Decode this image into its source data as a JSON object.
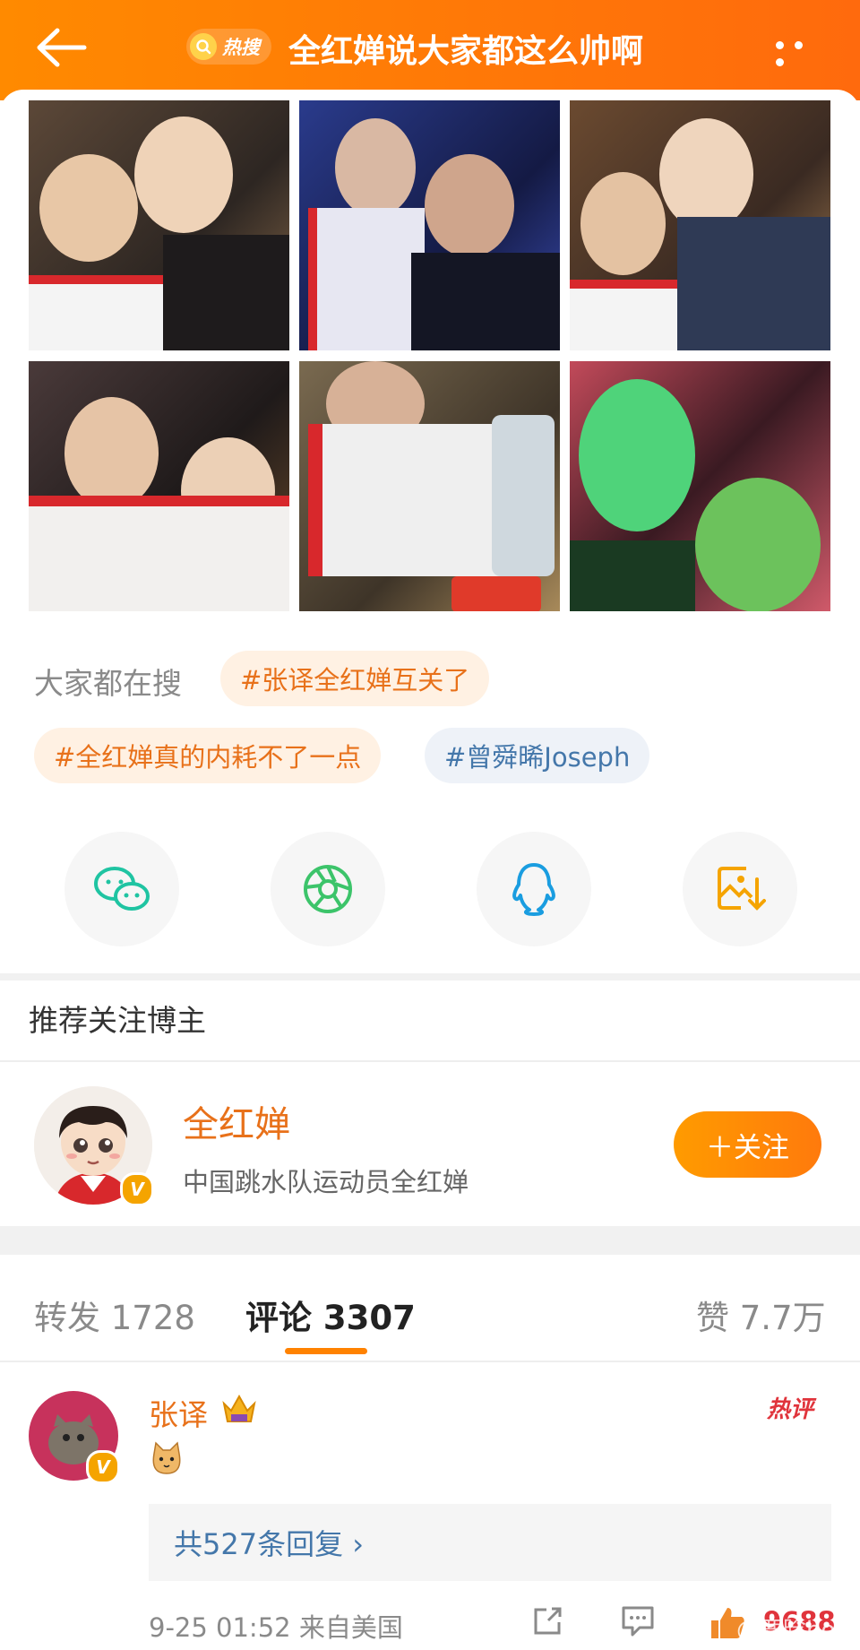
{
  "header": {
    "hot_badge_label": "热搜",
    "title": "全红婵说大家都这么帅啊"
  },
  "search": {
    "label": "大家都在搜",
    "tags": [
      {
        "text": "#张译全红婵互关了"
      },
      {
        "text": "#全红婵真的内耗不了一点"
      },
      {
        "text": "#曾舜晞Joseph"
      }
    ]
  },
  "share": {
    "icons": [
      "wechat-icon",
      "moments-icon",
      "qq-icon",
      "save-image-icon"
    ],
    "colors": {
      "wechat": "#1fc4a2",
      "moments": "#3cc46a",
      "qq": "#1a9de0",
      "save": "#f5a400"
    }
  },
  "recommend": {
    "section_title": "推荐关注博主",
    "name": "全红婵",
    "description": "中国跳水队运动员全红婵",
    "follow_label": "＋关注"
  },
  "tabs": {
    "repost": "转发 1728",
    "comment": "评论 3307",
    "like": "赞 7.7万"
  },
  "comment": {
    "author": "张译",
    "hot_label": "热评",
    "reply_count": "共527条回复 ›",
    "meta": "9-25 01:52 来自美国",
    "likes": "9688",
    "watermark": "@鹿晗bot"
  },
  "colors": {
    "accent": "#ff8200",
    "link": "#4477aa",
    "hot": "#e0343c"
  }
}
